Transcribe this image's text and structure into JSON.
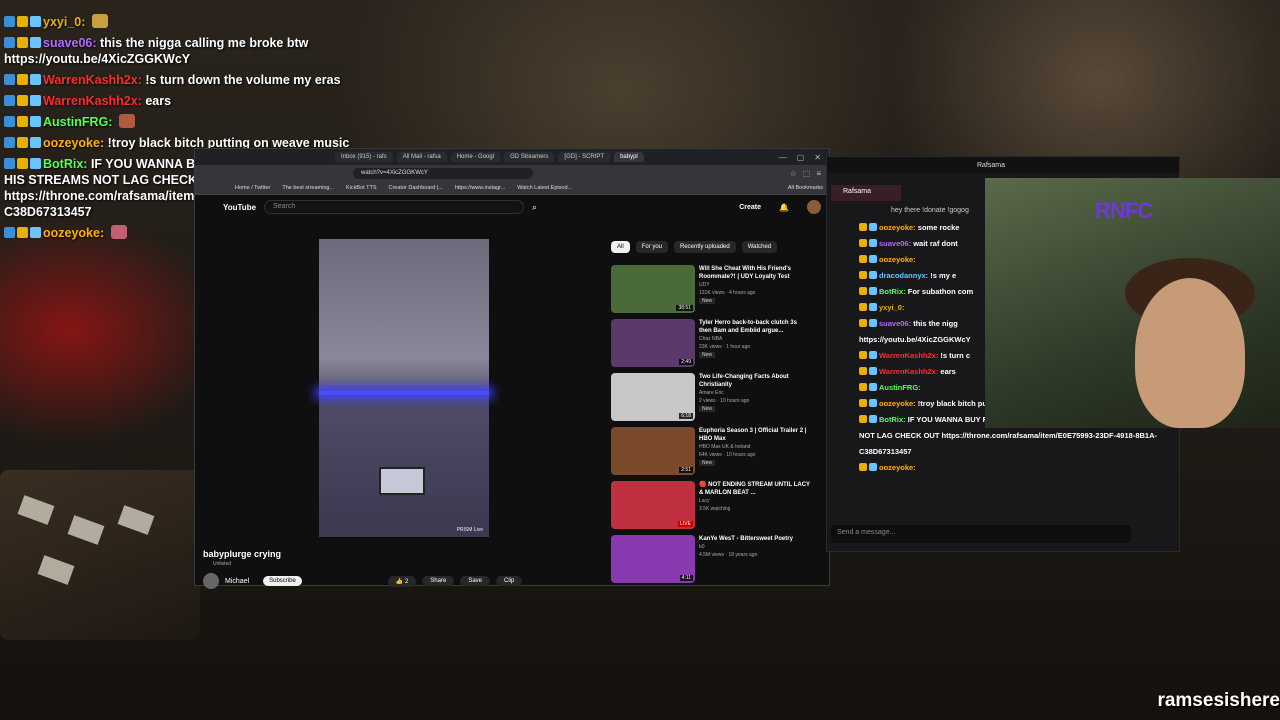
{
  "overlay_chat": [
    {
      "user": "yxyi_0:",
      "msg": "",
      "color": "#e8b000",
      "emote": "#c9a040"
    },
    {
      "user": "suave06:",
      "msg": "this the nigga calling me broke btw https://youtu.be/4XicZGGKWcY",
      "color": "#b26bff"
    },
    {
      "user": "WarrenKashh2x:",
      "msg": "!s turn down the volume my eras",
      "color": "#ff2a2a"
    },
    {
      "user": "WarrenKashh2x:",
      "msg": "ears",
      "color": "#ff2a2a"
    },
    {
      "user": "AustinFRG:",
      "msg": "",
      "color": "#55ff55",
      "emote": "#b05a40"
    },
    {
      "user": "oozeyoke:",
      "msg": "!troy black bitch putting on weave music",
      "color": "#ffb000"
    },
    {
      "user": "BotRix:",
      "msg": "IF YOU WANNA BUY RAF A NEW PC AND MAKE HIS STREAMS NOT LAG CHECK OUT https://throne.com/rafsama/item/E0E75993-23DF-4918-8B1A-C38D67313457",
      "color": "#55ff55"
    },
    {
      "user": "oozeyoke:",
      "msg": "",
      "color": "#ffb000",
      "emote": "#c06070"
    }
  ],
  "browser": {
    "tabs": [
      "Inbox (915) - rafs",
      "All Mail - rafsa",
      "Home - Googl",
      "GD Streamers",
      "[GD] - SCRIPT",
      "babypl"
    ],
    "url": "watch?v=4XicZGGKWcY",
    "bookmarks": [
      "Home / Twitter",
      "The best streaming...",
      "KickBot TTS",
      "Creator Dashboard |...",
      "https://www.instagr...",
      "Watch Latest Episod..."
    ],
    "all_bookmarks": "All Bookmarks"
  },
  "youtube": {
    "logo": "YouTube",
    "search_placeholder": "Search",
    "create": "Create",
    "watermark": "PRISM Live",
    "video_title": "babyplurge crying",
    "visibility": "Unlisted",
    "channel": "Michael",
    "subscribe": "Subscribe",
    "likes": "2",
    "share": "Share",
    "save": "Save",
    "clip": "Clip",
    "chips": [
      "All",
      "For you",
      "Recently uploaded",
      "Watched"
    ],
    "recs": [
      {
        "title": "Will She Cheat With His Friend's Roommate?! | UDY Loyalty Test",
        "channel": "UDY",
        "meta": "131K views · 4 hours ago",
        "badge": "New",
        "dur": "38:51",
        "color": "#4a6a3a"
      },
      {
        "title": "Tyler Herro back-to-back clutch 3s then Bam and Embiid argue...",
        "channel": "Chaz NBA",
        "meta": "23K views · 1 hour ago",
        "badge": "New",
        "dur": "2:49",
        "color": "#5a3a6a"
      },
      {
        "title": "Two Life-Changing Facts About Christianity",
        "channel": "Amare Eric",
        "meta": "2 views · 10 hours ago",
        "badge": "New",
        "dur": "6:18",
        "color": "#c8c8c8"
      },
      {
        "title": "Euphoria Season 3 | Official Trailer 2 | HBO Max",
        "channel": "HBO Max UK & Ireland",
        "meta": "64K views · 10 hours ago",
        "badge": "New",
        "dur": "2:51",
        "color": "#7a4a2a"
      },
      {
        "title": "🔴 NOT ENDING STREAM UNTIL LACY & MARLON BEAT ...",
        "channel": "Lacy",
        "meta": "3.5K watching",
        "badge": "",
        "dur": "LIVE",
        "color": "#c03040"
      },
      {
        "title": "KanYe WesT - Bittersweet Poetry",
        "channel": "b0",
        "meta": "4.5M views · 18 years ago",
        "badge": "",
        "dur": "4:11",
        "color": "#8a3ab0"
      }
    ]
  },
  "twitch": {
    "title": "Rafsama",
    "tab": "Rafsama",
    "info": "hey there !donate !gogog",
    "chat": [
      {
        "user": "oozeyoke:",
        "msg": "some rocke",
        "color": "#ffb000"
      },
      {
        "user": "suave06:",
        "msg": "wait raf dont",
        "color": "#b26bff"
      },
      {
        "user": "oozeyoke:",
        "msg": "",
        "color": "#ffb000"
      },
      {
        "user": "dracodannyx:",
        "msg": "!s my e",
        "color": "#6cc4ff"
      },
      {
        "user": "BotRix:",
        "msg": "For subathon com",
        "color": "#55ff55"
      },
      {
        "user": "yxyi_0:",
        "msg": "",
        "color": "#e8b000"
      },
      {
        "user": "suave06:",
        "msg": "this the nigg",
        "color": "#b26bff"
      },
      {
        "user": "",
        "msg": "https://youtu.be/4XicZGGKWcY",
        "color": "#fff"
      },
      {
        "user": "WarrenKashh2x:",
        "msg": "!s turn c",
        "color": "#ff2a2a"
      },
      {
        "user": "WarrenKashh2x:",
        "msg": "ears",
        "color": "#ff2a2a"
      },
      {
        "user": "AustinFRG:",
        "msg": "",
        "color": "#55ff55"
      },
      {
        "user": "oozeyoke:",
        "msg": "!troy black bitch putting on weave music",
        "color": "#ffb000"
      },
      {
        "user": "BotRix:",
        "msg": "IF YOU WANNA BUY RAF A NEW PC AND MAKE HIS STREAMS",
        "color": "#55ff55"
      },
      {
        "user": "",
        "msg": "NOT LAG CHECK OUT https://throne.com/rafsama/item/E0E75993-23DF-4918-8B1A-",
        "color": "#fff"
      },
      {
        "user": "",
        "msg": "C38D67313457",
        "color": "#fff"
      },
      {
        "user": "oozeyoke:",
        "msg": "",
        "color": "#ffb000"
      }
    ],
    "input_placeholder": "Send a message..."
  },
  "cam_logo": "RNFC",
  "watermark": "ramsesishere"
}
